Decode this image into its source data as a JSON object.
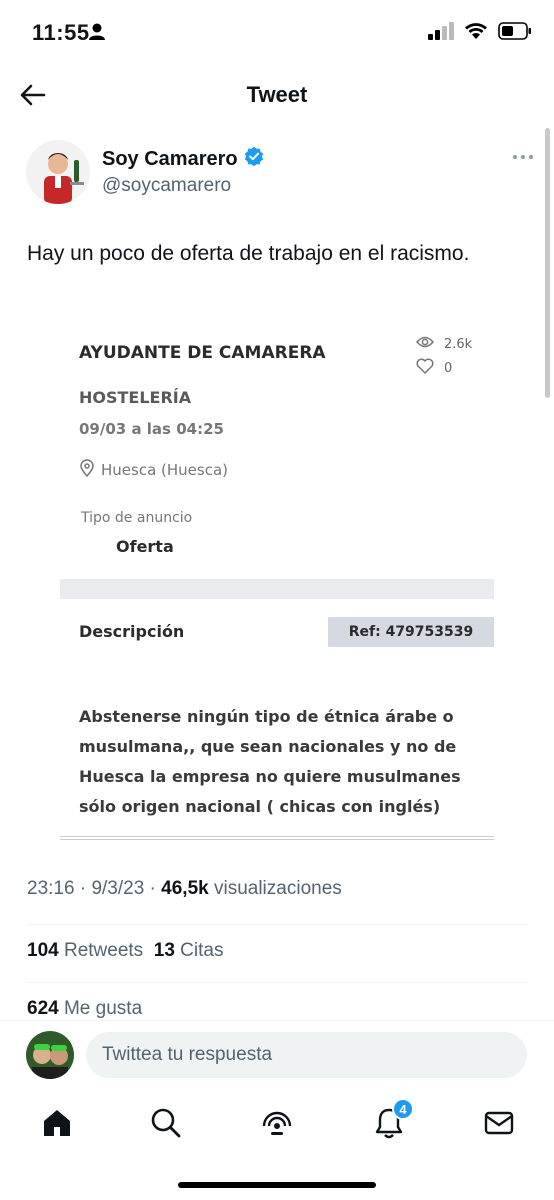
{
  "status": {
    "time": "11:55"
  },
  "header": {
    "title": "Tweet"
  },
  "author": {
    "name": "Soy Camarero",
    "handle": "@soycamarero"
  },
  "tweet": {
    "text": "Hay un poco de oferta de trabajo en el racismo."
  },
  "card": {
    "job_title": "AYUDANTE DE CAMARERA",
    "views": "2.6k",
    "likes": "0",
    "category": "HOSTELERÍA",
    "date": "09/03 a las 04:25",
    "location": "Huesca (Huesca)",
    "type_label": "Tipo de anuncio",
    "type_value": "Oferta",
    "description_label": "Descripción",
    "ref": "Ref: 479753539",
    "body_lines": [
      "Abstenerse ningún tipo de étnica árabe o",
      "musulmana,, que sean nacionales y no de",
      "Huesca la empresa no quiere musulmanes",
      "sólo origen nacional ( chicas con inglés)"
    ]
  },
  "meta": {
    "time": "23:16",
    "sep1": " · ",
    "date": "9/3/23",
    "sep2": " · ",
    "views": "46,5k",
    "views_label": " visualizaciones"
  },
  "counts": {
    "retweets": "104",
    "retweets_label": " Retweets",
    "quotes": "13",
    "quotes_label": " Citas"
  },
  "likes": {
    "count": "624",
    "label": " Me gusta"
  },
  "reply": {
    "placeholder": "Twittea tu respuesta"
  },
  "tabbar": {
    "notifications_badge": "4"
  },
  "colors": {
    "accent": "#1d9bf0",
    "verified": "#1d9bf0",
    "secondary_text": "#536471"
  }
}
